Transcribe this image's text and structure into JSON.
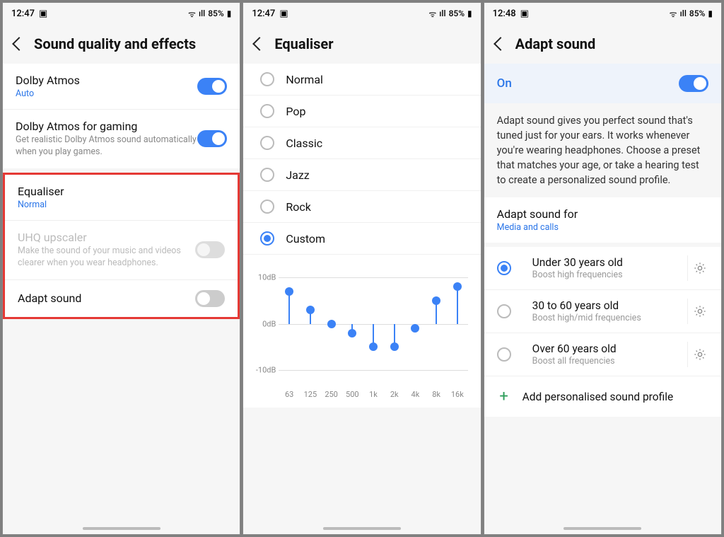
{
  "screen1": {
    "time": "12:47",
    "battery": "85%",
    "title": "Sound quality and effects",
    "items": [
      {
        "title": "Dolby Atmos",
        "value": "Auto",
        "toggle": "on"
      },
      {
        "title": "Dolby Atmos for gaming",
        "sub": "Get realistic Dolby Atmos sound automatically when you play games.",
        "toggle": "on"
      }
    ],
    "highlight": [
      {
        "title": "Equaliser",
        "value": "Normal"
      },
      {
        "title": "UHQ upscaler",
        "sub": "Make the sound of your music and videos clearer when you wear headphones.",
        "toggle": "off",
        "disabled": true
      },
      {
        "title": "Adapt sound",
        "toggle": "off"
      }
    ]
  },
  "screen2": {
    "time": "12:47",
    "battery": "85%",
    "title": "Equaliser",
    "options": [
      {
        "label": "Normal",
        "checked": false
      },
      {
        "label": "Pop",
        "checked": false
      },
      {
        "label": "Classic",
        "checked": false
      },
      {
        "label": "Jazz",
        "checked": false
      },
      {
        "label": "Rock",
        "checked": false
      },
      {
        "label": "Custom",
        "checked": true
      }
    ]
  },
  "chart_data": {
    "type": "bar",
    "categories": [
      "63",
      "125",
      "250",
      "500",
      "1k",
      "2k",
      "4k",
      "8k",
      "16k"
    ],
    "values": [
      7,
      3,
      0,
      -2,
      -5,
      -5,
      -1,
      5,
      8
    ],
    "ylabels": [
      "10dB",
      "0dB",
      "-10dB"
    ],
    "ylim": [
      -10,
      10
    ],
    "xlabel": "",
    "ylabel": "",
    "title": ""
  },
  "screen3": {
    "time": "12:48",
    "battery": "85%",
    "title": "Adapt sound",
    "on_label": "On",
    "description": "Adapt sound gives you perfect sound that's tuned just for your ears. It works whenever you're wearing headphones. Choose a preset that matches your age, or take a hearing test to create a personalized sound profile.",
    "for_title": "Adapt sound for",
    "for_value": "Media and calls",
    "ages": [
      {
        "title": "Under 30 years old",
        "sub": "Boost high frequencies",
        "checked": true
      },
      {
        "title": "30 to 60 years old",
        "sub": "Boost high/mid frequencies",
        "checked": false
      },
      {
        "title": "Over 60 years old",
        "sub": "Boost all frequencies",
        "checked": false
      }
    ],
    "add_label": "Add personalised sound profile"
  },
  "icons": {
    "img": "▣",
    "wifi": "ᯤ",
    "signal": "▲",
    "batt": "▮"
  }
}
